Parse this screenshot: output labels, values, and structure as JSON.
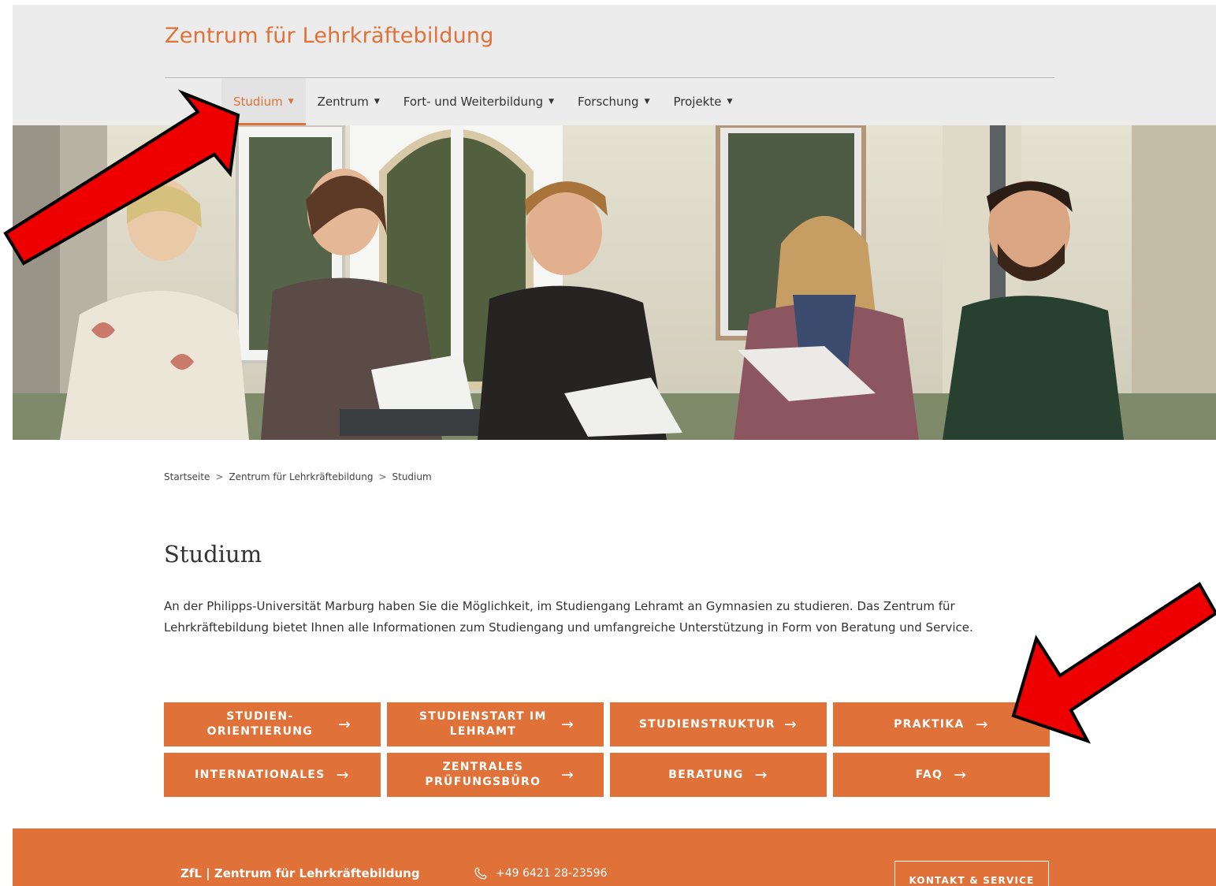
{
  "header": {
    "site_title": "Zentrum für Lehrkräftebildung"
  },
  "nav": {
    "items": [
      {
        "label": "Studium",
        "active": true
      },
      {
        "label": "Zentrum",
        "active": false
      },
      {
        "label": "Fort- und Weiterbildung",
        "active": false
      },
      {
        "label": "Forschung",
        "active": false
      },
      {
        "label": "Projekte",
        "active": false
      }
    ]
  },
  "breadcrumb": {
    "items": [
      "Startseite",
      "Zentrum für Lehrkräftebildung",
      "Studium"
    ],
    "separator": ">"
  },
  "main": {
    "title": "Studium",
    "intro": "An der Philipps-Universität Marburg haben Sie die Möglichkeit, im Studiengang Lehramt an Gymnasien zu studieren. Das Zentrum für Lehrkräftebildung bietet Ihnen alle Informationen zum Studiengang und umfangreiche Unterstützung in Form von Beratung und Service.",
    "tiles": [
      {
        "label": "STUDIEN-ORIENTIERUNG"
      },
      {
        "label": "STUDIENSTART IM LEHRAMT"
      },
      {
        "label": "STUDIENSTRUKTUR"
      },
      {
        "label": "PRAKTIKA"
      },
      {
        "label": "INTERNATIONALES"
      },
      {
        "label": "ZENTRALES PRÜFUNGSBÜRO"
      },
      {
        "label": "BERATUNG"
      },
      {
        "label": "FAQ"
      }
    ],
    "tile_arrow": "→"
  },
  "footer": {
    "name": "ZfL | Zentrum für Lehrkräftebildung",
    "phone": "+49 6421 28-23596",
    "contact_button": "KONTAKT & SERVICE"
  },
  "colors": {
    "accent": "#e07138",
    "header_bg": "#ececec",
    "annotation_arrow": "#ee0000"
  },
  "icons": {
    "nav_caret": "caret-down-icon",
    "tile_arrow": "arrow-right-icon",
    "phone": "phone-icon"
  }
}
